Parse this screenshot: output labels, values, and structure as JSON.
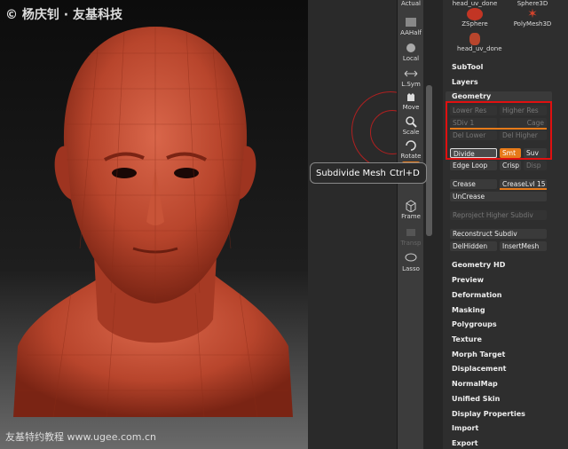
{
  "viewport": {
    "watermark": "© 杨庆钊 · 友基科技",
    "footer": "友基特约教程 www.ugee.com.cn"
  },
  "tooltip": {
    "label": "Subdivide Mesh",
    "shortcut": "Ctrl+D"
  },
  "shelf": [
    {
      "label": "Actual"
    },
    {
      "label": "AAHalf"
    },
    {
      "label": "Local"
    },
    {
      "label": "L.Sym"
    },
    {
      "label": "Move"
    },
    {
      "label": "Scale"
    },
    {
      "label": "Rotate"
    },
    {
      "label": "Frame"
    },
    {
      "label": "Transp"
    },
    {
      "label": "Lasso"
    }
  ],
  "mesh_thumbs": [
    {
      "label": "head_uv_done"
    },
    {
      "label": "Sphere3D"
    },
    {
      "label": "ZSphere"
    },
    {
      "label": "PolyMesh3D"
    },
    {
      "label": "head_uv_done"
    }
  ],
  "panel": {
    "subtool": "SubTool",
    "layers": "Layers",
    "geometry": "Geometry",
    "lower_res": "Lower Res",
    "higher_res": "Higher Res",
    "sdiv": "SDiv 1",
    "cage": "Cage",
    "del_lower": "Del Lower",
    "del_higher": "Del Higher",
    "divide": "Divide",
    "smt": "Smt",
    "suv": "Suv",
    "edge_loop": "Edge Loop",
    "crisp": "Crisp",
    "disp": "Disp",
    "crease": "Crease",
    "crease_lvl": "CreaseLvl 15",
    "uncrease": "UnCrease",
    "reproject": "Reproject Higher Subdiv",
    "reconstruct": "Reconstruct Subdiv",
    "del_hidden": "DelHidden",
    "insert_mesh": "InsertMesh",
    "sections": [
      "Geometry HD",
      "Preview",
      "Deformation",
      "Masking",
      "Polygroups",
      "Texture",
      "Morph Target",
      "Displacement",
      "NormalMap",
      "Unified Skin",
      "Display Properties",
      "Import",
      "Export"
    ]
  }
}
